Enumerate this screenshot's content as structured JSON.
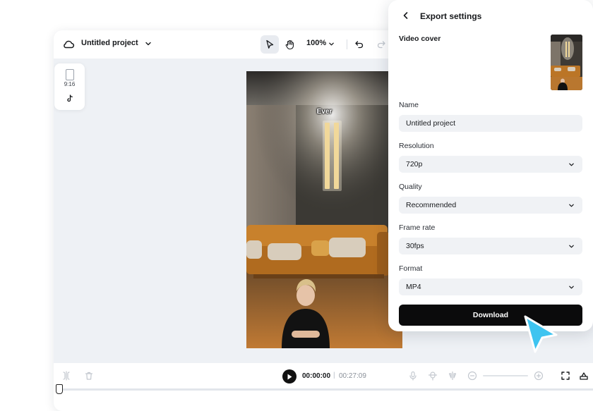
{
  "editor": {
    "project_title": "Untitled project",
    "zoom": "100%",
    "aspect_ratio": "9:16",
    "caption": "Ever",
    "time_current": "00:00:00",
    "time_separator": "|",
    "time_total": "00:27:09"
  },
  "export_panel": {
    "title": "Export settings",
    "cover_label": "Video cover",
    "name_label": "Name",
    "name_value": "Untitled project",
    "resolution_label": "Resolution",
    "resolution_value": "720p",
    "quality_label": "Quality",
    "quality_value": "Recommended",
    "frame_rate_label": "Frame rate",
    "frame_rate_value": "30fps",
    "format_label": "Format",
    "format_value": "MP4",
    "download_label": "Download"
  },
  "colors": {
    "accent_cursor": "#3ec4f0",
    "download_button": "#0b0b0c",
    "canvas_background": "#eef1f5"
  },
  "icons": [
    "cloud-icon",
    "chevron-down-icon",
    "select-pointer-icon",
    "hand-icon",
    "undo-icon",
    "redo-icon",
    "phone-ratio-icon",
    "tiktok-icon",
    "split-icon",
    "delete-icon",
    "play-icon",
    "microphone-icon",
    "voice-effect-icon",
    "mirror-icon",
    "zoom-out-icon",
    "zoom-in-icon",
    "fullscreen-icon",
    "back-chevron-icon",
    "pointer-cursor-icon"
  ]
}
